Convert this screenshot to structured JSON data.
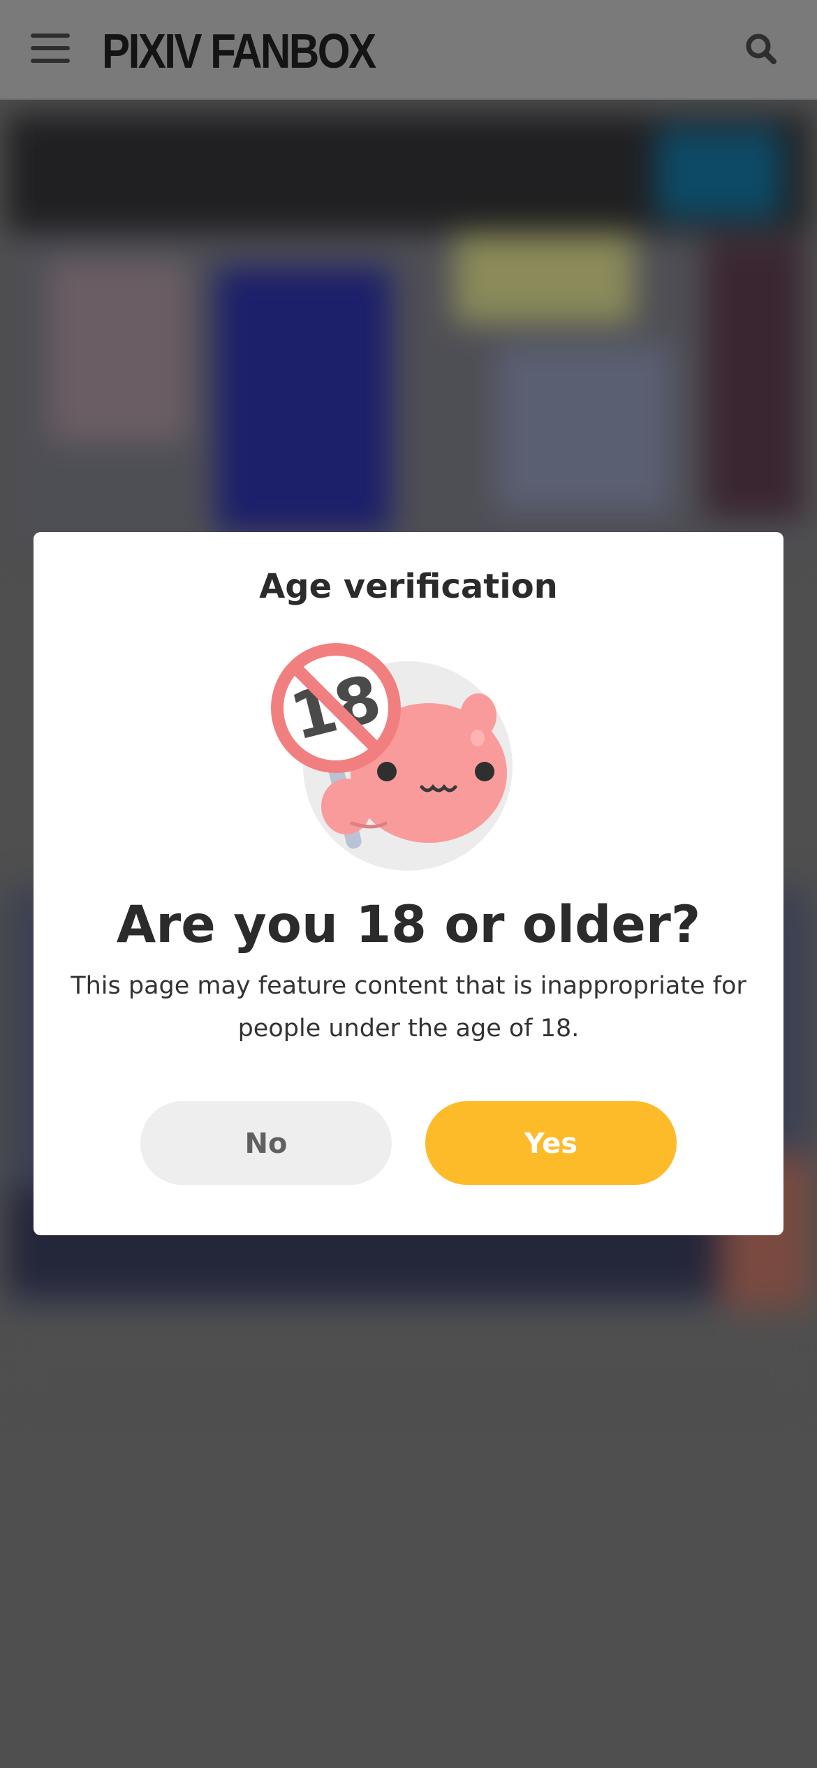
{
  "header": {
    "brand": "PIXIV FANBOX",
    "menu_icon": "hamburger-menu-icon",
    "search_icon": "search-icon",
    "background_color": "#7a7a7a"
  },
  "overlay": {
    "background_color": "#4f4f4f"
  },
  "age_modal": {
    "title": "Age verification",
    "illustration": "pink-mascot-with-no-under-18-sign",
    "question": "Are you 18 or older?",
    "description": "This page may feature content that is inappropriate for people under the age of 18.",
    "no_label": "No",
    "yes_label": "Yes",
    "colors": {
      "yes_button": "#fdbb2a",
      "no_button": "#eeeeee",
      "text": "#2b2b2b"
    }
  }
}
